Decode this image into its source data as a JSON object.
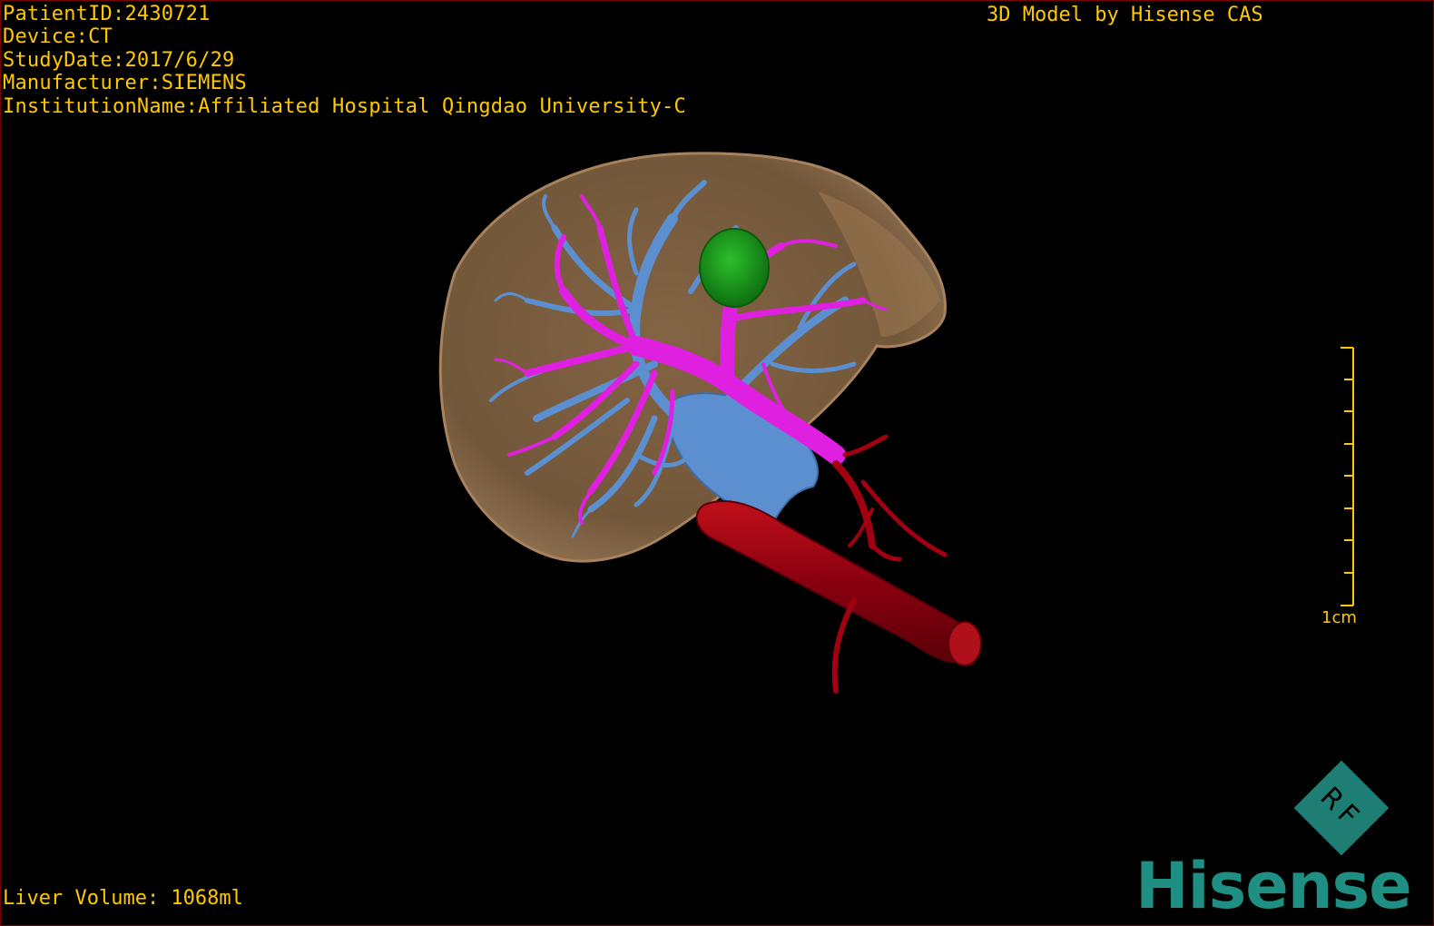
{
  "overlay": {
    "patient_id": "PatientID:2430721",
    "device": "Device:CT",
    "study_date": "StudyDate:2017/6/29",
    "manufacturer": "Manufacturer:SIEMENS",
    "institution": "InstitutionName:Affiliated Hospital Qingdao University-C",
    "credit": "3D Model by Hisense CAS",
    "liver_volume": "Liver Volume: 1068ml"
  },
  "scale_bar": {
    "label": "1cm"
  },
  "branding": {
    "logo_text": "Hisense",
    "badge_text": "RF"
  },
  "colors": {
    "overlay_text": "#ffc800",
    "liver": "#a07850",
    "portal_vein": "#e020e0",
    "hepatic_vein": "#5b8fd0",
    "tumor": "#1a9a1a",
    "artery": "#a00010",
    "brand": "#1f8f84"
  }
}
